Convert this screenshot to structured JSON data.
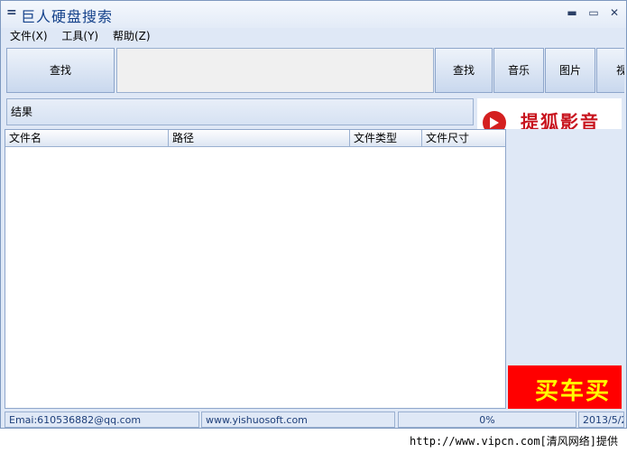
{
  "window": {
    "title": "巨人硬盘搜索",
    "sysmenu_glyph": "=",
    "minimize_glyph": "▬",
    "maximize_glyph": "▭",
    "close_glyph": "✕"
  },
  "menubar": {
    "items": [
      {
        "label": "文件(X)"
      },
      {
        "label": "工具(Y)"
      },
      {
        "label": "帮助(Z)"
      }
    ]
  },
  "toolbar": {
    "search_button": "查找",
    "search_input_value": "",
    "tabs": [
      {
        "label": "查找"
      },
      {
        "label": "音乐"
      },
      {
        "label": "图片"
      },
      {
        "label": "视"
      }
    ]
  },
  "results": {
    "label": "结果",
    "columns": [
      "文件名",
      "路径",
      "文件类型",
      "文件尺寸"
    ],
    "rows": []
  },
  "ads": {
    "logo_text": "提狐影音",
    "banner_text": "买车买"
  },
  "statusbar": {
    "email": "Emai:610536882@qq.com",
    "website": "www.yishuosoft.com",
    "progress": "0%",
    "date": "2013/5/2"
  },
  "watermark": "http://www.vipcn.com[清风网络]提供",
  "colors": {
    "accent": "#15428b",
    "window_bg": "#dfe8f6",
    "ad_red": "#ff0000",
    "ad_yellow": "#ffff00"
  }
}
